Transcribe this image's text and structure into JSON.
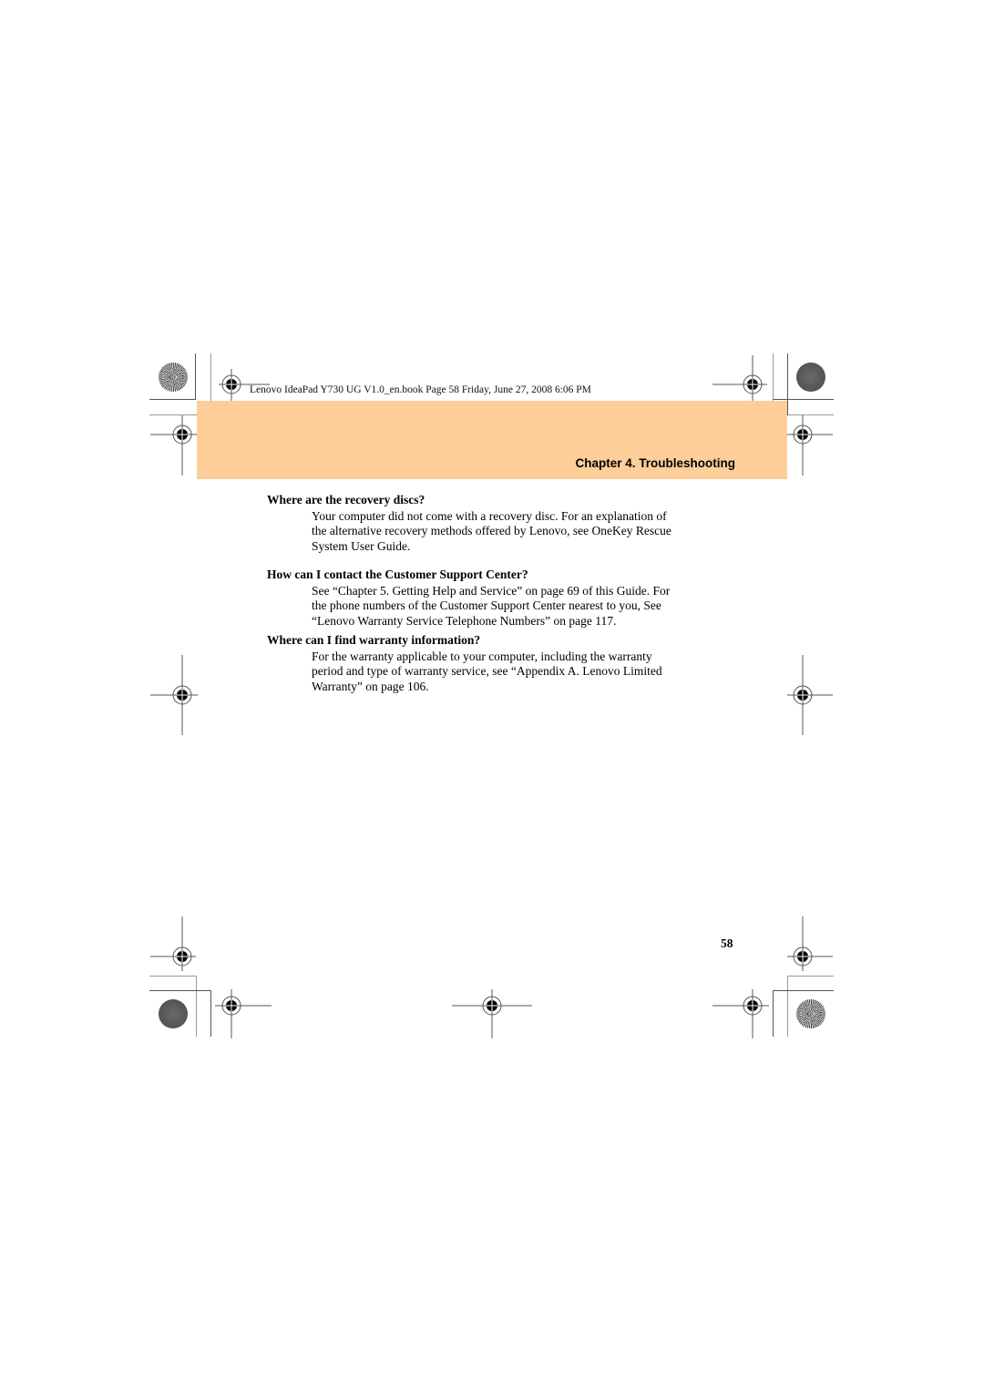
{
  "document": {
    "print_info": "Lenovo IdeaPad Y730 UG V1.0_en.book  Page 58  Friday, June 27, 2008  6:06 PM",
    "chapter_header": "Chapter 4. Troubleshooting",
    "header_band_color": "#fdce9a",
    "sections": [
      {
        "question": "Where are the recovery discs?",
        "answer_lines": [
          "Your computer did not come with a recovery disc. For an explanation of",
          "the alternative recovery methods offered by Lenovo, see OneKey Rescue",
          "System User Guide."
        ]
      },
      {
        "question": "How can I contact the Customer Support Center?",
        "answer_lines": [
          "See “Chapter 5. Getting Help and Service” on page 69 of this Guide. For",
          "the phone numbers of the Customer Support Center nearest to you, See",
          "“Lenovo Warranty Service Telephone Numbers” on page 117."
        ]
      },
      {
        "question": "Where can I find warranty information?",
        "answer_lines": [
          "For the warranty applicable to your computer, including the warranty",
          "period and type of warranty service, see “Appendix A. Lenovo Limited",
          "Warranty” on page 106."
        ]
      }
    ],
    "page_number": "58"
  },
  "marks": {
    "registration_icon": "crosshair-registration-mark",
    "corner_icon_radial": "starburst-registration-mark",
    "corner_icon_solid": "solid-gray-disc-mark"
  }
}
